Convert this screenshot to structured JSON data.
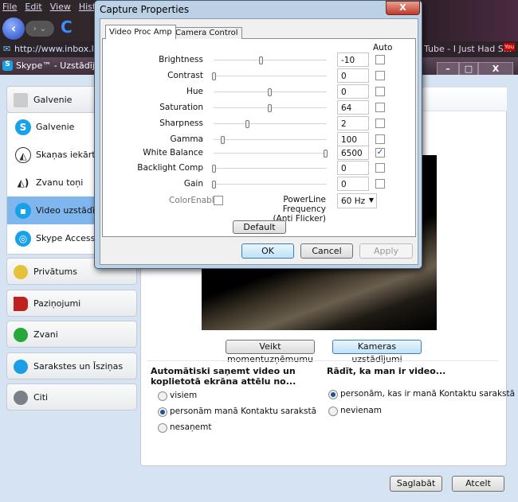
{
  "browser": {
    "menu": [
      "File",
      "Edit",
      "View",
      "Histo"
    ],
    "address": "http://www.inbox.lv",
    "tab_right": "Tube - I Just Had S..."
  },
  "skype": {
    "title": "Skype™ - Uzstādījun",
    "sidebar": {
      "groups_top": {
        "label": "Galvenie"
      },
      "items": [
        {
          "label": "Galvenie",
          "icon": "skype-icon"
        },
        {
          "label": "Skaņas iekārtas",
          "icon": "speaker-headset-icon"
        },
        {
          "label": "Zvanu toņi",
          "icon": "ringtone-icon"
        },
        {
          "label": "Video uzstādījumi",
          "icon": "video-icon",
          "selected": true
        },
        {
          "label": "Skype Access",
          "icon": "wifi-icon"
        }
      ],
      "groups": [
        {
          "label": "Privātums",
          "icon": "key-lock-icon"
        },
        {
          "label": "Paziņojumi",
          "icon": "flag-icon"
        },
        {
          "label": "Zvani",
          "icon": "phone-icon"
        },
        {
          "label": "Sarakstes un Īsziņas",
          "icon": "chat-icon"
        },
        {
          "label": "Citi",
          "icon": "gear-icon"
        }
      ]
    },
    "snapshot_button": "Veikt momentuzņēmumu",
    "camera_settings_button": "Kameras uzstādījumi",
    "receive": {
      "heading": "Automātiski saņemt video un koplietotā ekrāna attēlu no...",
      "options": [
        "visiem",
        "personām manā Kontaktu sarakstā",
        "nesaņemt"
      ],
      "selected": 1
    },
    "show": {
      "heading": "Rādīt, ka man ir video...",
      "options": [
        "personām, kas ir manā Kontaktu sarakstā",
        "nevienam"
      ],
      "selected": 0
    },
    "save": "Saglabāt",
    "cancel": "Atcelt"
  },
  "dialog": {
    "title": "Capture Properties",
    "close": "X",
    "tabs": [
      "Video Proc Amp",
      "Camera Control"
    ],
    "active_tab": 0,
    "auto_header": "Auto",
    "rows": [
      {
        "label": "Brightness",
        "value": "-10",
        "pos": 0.42,
        "auto": false
      },
      {
        "label": "Contrast",
        "value": "0",
        "pos": 0.0,
        "auto": false
      },
      {
        "label": "Hue",
        "value": "0",
        "pos": 0.5,
        "auto": false
      },
      {
        "label": "Saturation",
        "value": "64",
        "pos": 0.5,
        "auto": false
      },
      {
        "label": "Sharpness",
        "value": "2",
        "pos": 0.3,
        "auto": false
      },
      {
        "label": "Gamma",
        "value": "100",
        "pos": 0.08,
        "auto": false
      },
      {
        "label": "White Balance",
        "value": "6500",
        "pos": 1.0,
        "auto": true
      },
      {
        "label": "Backlight Comp",
        "value": "0",
        "pos": 0.0,
        "auto": false
      },
      {
        "label": "Gain",
        "value": "0",
        "pos": 0.0,
        "auto": false
      }
    ],
    "color_enable": "ColorEnable",
    "powerline_label": "PowerLine Frequency",
    "powerline_sub": "(Anti Flicker)",
    "powerline_value": "60 Hz",
    "default": "Default",
    "ok": "OK",
    "cancel": "Cancel",
    "apply": "Apply"
  }
}
